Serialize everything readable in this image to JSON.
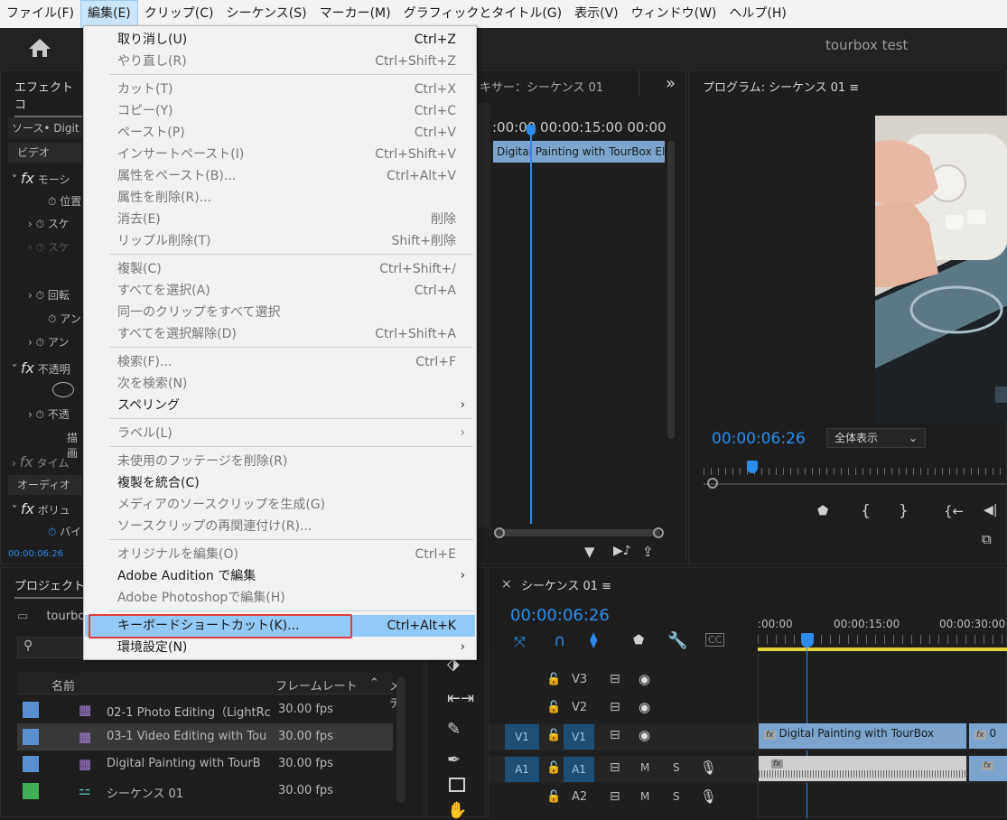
{
  "menubar": {
    "items": [
      {
        "label": "ファイル(F)"
      },
      {
        "label": "編集(E)"
      },
      {
        "label": "クリップ(C)"
      },
      {
        "label": "シーケンス(S)"
      },
      {
        "label": "マーカー(M)"
      },
      {
        "label": "グラフィックとタイトル(G)"
      },
      {
        "label": "表示(V)"
      },
      {
        "label": "ウィンドウ(W)"
      },
      {
        "label": "ヘルプ(H)"
      }
    ]
  },
  "header": {
    "title": "tourbox test"
  },
  "effect_controls": {
    "tab": "エフェクトコ",
    "source": "ソース• Digit",
    "video_section": "ビデオ",
    "motion": "モーシ",
    "position": "位置",
    "scale": "スケ",
    "scale2": "スケ",
    "rotation": "回転",
    "anchor": "アン",
    "anchor2": "アン",
    "opacity": "不透明",
    "opacity2": "不透",
    "blend": "描画",
    "time": "タイム",
    "audio_section": "オーディオ",
    "volume": "ボリュ",
    "bypass": "バイ",
    "timecode": "00:00:06:26"
  },
  "audio_mixer": {
    "tab": "キサー：シーケンス 01",
    "ruler": ":00:00 00:00:15:00 00:00",
    "clip": "Digital Painting with TourBox El"
  },
  "program": {
    "tab": "プログラム: シーケンス 01",
    "timecode": "00:00:06:26",
    "zoom": "全体表示"
  },
  "project": {
    "tab": "プロジェクト",
    "folder": "tourbo",
    "columns": {
      "name": "名前",
      "framerate": "フレームレート",
      "media": "メデ"
    },
    "rows": [
      {
        "name": "02-1 Photo Editing（LightRc",
        "fps": "30.00 fps",
        "color": "#5a8fd0"
      },
      {
        "name": "03-1 Video Editing with Tou",
        "fps": "30.00 fps",
        "color": "#5a8fd0"
      },
      {
        "name": "Digital Painting with TourB",
        "fps": "30.00 fps",
        "color": "#5a8fd0"
      },
      {
        "name": "シーケンス 01",
        "fps": "30.00 fps",
        "color": "#3fae56"
      }
    ]
  },
  "timeline": {
    "tab": "シーケンス 01",
    "close": "×",
    "timecode": "00:00:06:26",
    "ruler": [
      ":00:00",
      "00:00:15:00",
      "00:00:30:00"
    ],
    "tracks": [
      {
        "label": "V3"
      },
      {
        "label": "V2"
      },
      {
        "label": "V1",
        "src": "V1"
      },
      {
        "label": "A1",
        "src": "A1",
        "m": "M",
        "s": "S"
      },
      {
        "label": "A2",
        "m": "M",
        "s": "S"
      }
    ],
    "clip_v1": "Digital Painting with TourBox",
    "clip_v1b": "0"
  },
  "edit_menu": {
    "items": [
      {
        "label": "取り消し(U)",
        "shortcut": "Ctrl+Z"
      },
      {
        "label": "やり直し(R)",
        "shortcut": "Ctrl+Shift+Z"
      },
      {
        "label": "カット(T)",
        "shortcut": "Ctrl+X"
      },
      {
        "label": "コピー(Y)",
        "shortcut": "Ctrl+C"
      },
      {
        "label": "ペースト(P)",
        "shortcut": "Ctrl+V"
      },
      {
        "label": "インサートペースト(I)",
        "shortcut": "Ctrl+Shift+V"
      },
      {
        "label": "属性をペースト(B)...",
        "shortcut": "Ctrl+Alt+V"
      },
      {
        "label": "属性を削除(R)...",
        "shortcut": ""
      },
      {
        "label": "消去(E)",
        "shortcut": "削除"
      },
      {
        "label": "リップル削除(T)",
        "shortcut": "Shift+削除"
      },
      {
        "label": "複製(C)",
        "shortcut": "Ctrl+Shift+/"
      },
      {
        "label": "すべてを選択(A)",
        "shortcut": "Ctrl+A"
      },
      {
        "label": "同一のクリップをすべて選択",
        "shortcut": ""
      },
      {
        "label": "すべてを選択解除(D)",
        "shortcut": "Ctrl+Shift+A"
      },
      {
        "label": "検索(F)...",
        "shortcut": "Ctrl+F"
      },
      {
        "label": "次を検索(N)",
        "shortcut": ""
      },
      {
        "label": "スペリング",
        "shortcut": ""
      },
      {
        "label": "ラベル(L)",
        "shortcut": ""
      },
      {
        "label": "未使用のフッテージを削除(R)",
        "shortcut": ""
      },
      {
        "label": "複製を統合(C)",
        "shortcut": ""
      },
      {
        "label": "メディアのソースクリップを生成(G)",
        "shortcut": ""
      },
      {
        "label": "ソースクリップの再関連付け(R)...",
        "shortcut": ""
      },
      {
        "label": "オリジナルを編集(O)",
        "shortcut": "Ctrl+E"
      },
      {
        "label": "Adobe Audition で編集",
        "shortcut": ""
      },
      {
        "label": "Adobe Photoshopで編集(H)",
        "shortcut": ""
      },
      {
        "label": "キーボードショートカット(K)...",
        "shortcut": "Ctrl+Alt+K"
      },
      {
        "label": "環境設定(N)",
        "shortcut": ""
      }
    ],
    "submenu_arrow": "›"
  }
}
